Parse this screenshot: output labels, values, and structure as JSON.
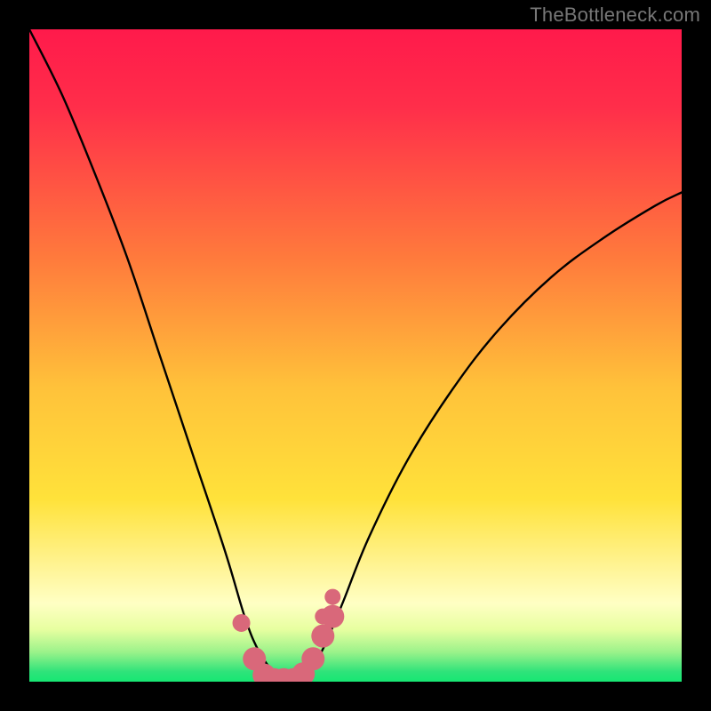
{
  "watermark": "TheBottleneck.com",
  "colors": {
    "frame_bg": "#000000",
    "curve": "#000000",
    "markers": "#d9687a",
    "gradient_top": "#ff1a4b",
    "gradient_yellow": "#ffe23a",
    "gradient_pale": "#ffffc4",
    "gradient_green": "#2ee37a"
  },
  "chart_data": {
    "type": "line",
    "title": "",
    "xlabel": "",
    "ylabel": "",
    "xlim": [
      0,
      100
    ],
    "ylim": [
      0,
      100
    ],
    "series": [
      {
        "name": "bottleneck-curve",
        "x": [
          0,
          5,
          10,
          15,
          20,
          25,
          30,
          33,
          35,
          37,
          39,
          41,
          43,
          45,
          48,
          52,
          58,
          65,
          72,
          80,
          88,
          96,
          100
        ],
        "y": [
          100,
          90,
          78,
          65,
          50,
          35,
          20,
          10,
          5,
          2,
          0.5,
          0.5,
          2,
          5,
          12,
          22,
          34,
          45,
          54,
          62,
          68,
          73,
          75
        ]
      }
    ],
    "markers": {
      "name": "highlight-dots",
      "x": [
        32.5,
        34.5,
        36,
        37.5,
        39,
        40.5,
        42,
        43.5,
        45,
        45,
        46.5,
        46.5
      ],
      "y": [
        9,
        3.5,
        1,
        0.3,
        0.3,
        0.3,
        1.2,
        3.5,
        7,
        10,
        10,
        13
      ],
      "size": [
        10,
        13,
        13,
        13,
        13,
        13,
        13,
        13,
        13,
        9,
        13,
        9
      ]
    },
    "gradient_stops": [
      {
        "offset": 0.0,
        "color": "#ff1a4b"
      },
      {
        "offset": 0.12,
        "color": "#ff2e4a"
      },
      {
        "offset": 0.35,
        "color": "#ff7a3c"
      },
      {
        "offset": 0.55,
        "color": "#ffc23a"
      },
      {
        "offset": 0.72,
        "color": "#ffe23a"
      },
      {
        "offset": 0.83,
        "color": "#fff59a"
      },
      {
        "offset": 0.88,
        "color": "#ffffc4"
      },
      {
        "offset": 0.92,
        "color": "#e7ffa0"
      },
      {
        "offset": 0.955,
        "color": "#9af28a"
      },
      {
        "offset": 0.985,
        "color": "#2ee37a"
      },
      {
        "offset": 1.0,
        "color": "#17e773"
      }
    ]
  }
}
